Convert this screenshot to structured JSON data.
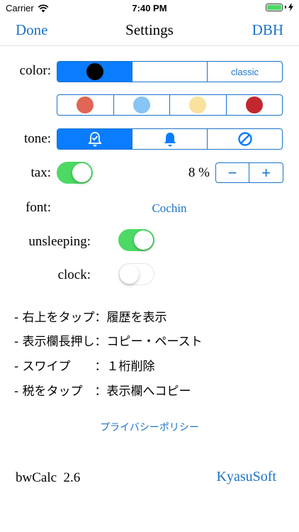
{
  "status": {
    "carrier": "Carrier",
    "time": "7:40 PM"
  },
  "nav": {
    "left": "Done",
    "title": "Settings",
    "right": "DBH"
  },
  "color": {
    "label": "color:",
    "options": [
      "black",
      "white",
      "classic"
    ],
    "classic_label": "classic",
    "selected_index": 0,
    "swatches": [
      "#e06655",
      "#88c4f4",
      "#f8e29c",
      "#c2272d"
    ]
  },
  "tone": {
    "label": "tone:",
    "options": [
      "bell-check",
      "bell",
      "no-sound"
    ],
    "selected_index": 0
  },
  "tax": {
    "label": "tax:",
    "enabled": true,
    "rate_text": "8 %",
    "minus": "−",
    "plus": "+"
  },
  "font": {
    "label": "font:",
    "value": "Cochin"
  },
  "unsleeping": {
    "label": "unsleeping:",
    "enabled": true
  },
  "clock": {
    "label": "clock:",
    "enabled": false
  },
  "hints": [
    "- 右上をタップ：履歴を表示",
    "- 表示欄長押し：コピー・ペースト",
    "- スワイプ　　：１桁削除",
    "- 税をタップ　：表示欄へコピー"
  ],
  "privacy_link": "プライバシーポリシー",
  "footer": {
    "version": "bwCalc  2.6",
    "company": "KyasuSoft"
  },
  "colors": {
    "accent": "#1a73c9",
    "selected": "#0a7cff",
    "switch_on": "#4cd964"
  }
}
